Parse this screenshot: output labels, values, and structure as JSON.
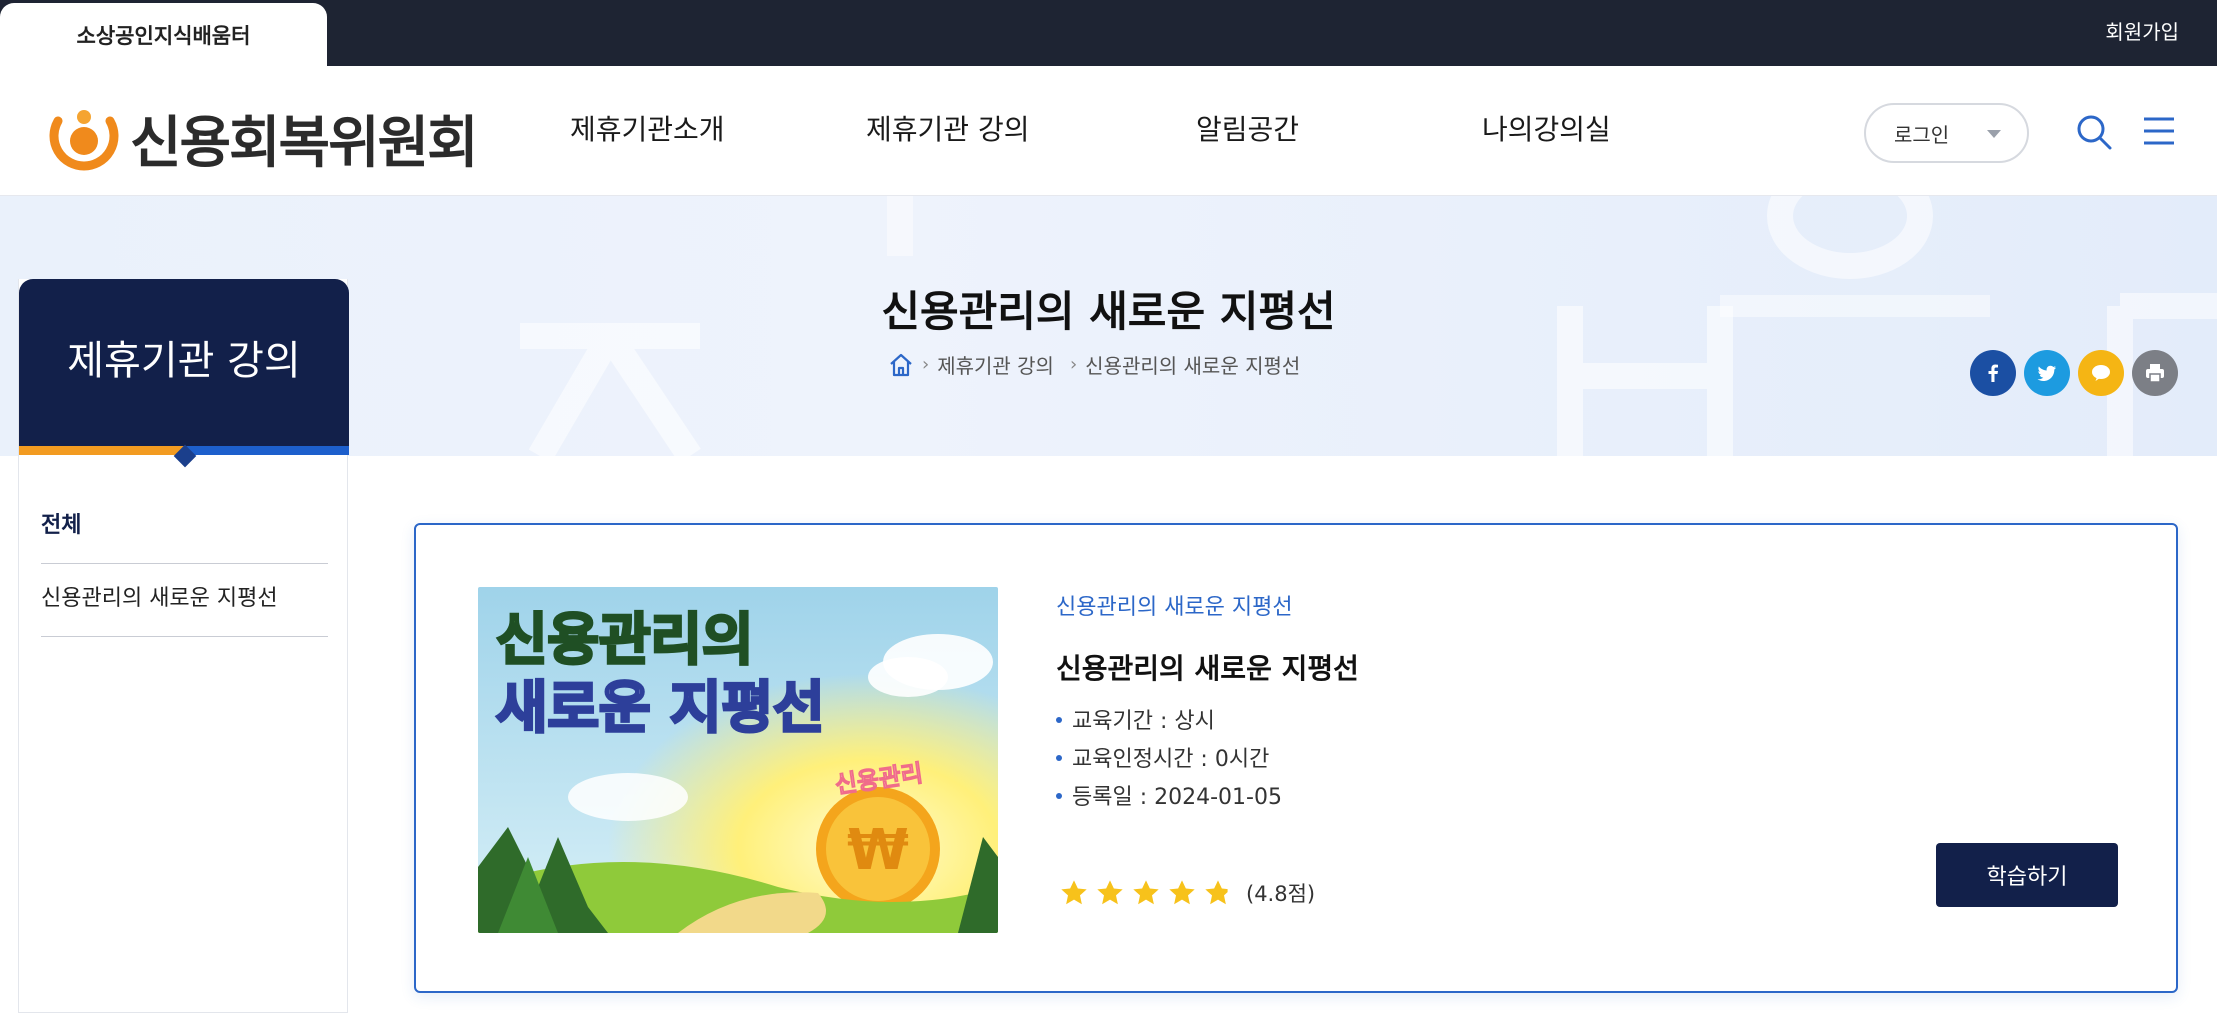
{
  "topbar": {
    "site_tab": "소상공인지식배움터",
    "signup": "회원가입"
  },
  "header": {
    "logo_text": "신용회복위원회",
    "nav": [
      "제휴기관소개",
      "제휴기관 강의",
      "알림공간",
      "나의강의실"
    ],
    "login_select": "로그인"
  },
  "hero": {
    "title": "신용관리의 새로운 지평선",
    "breadcrumb": [
      "제휴기관 강의",
      "신용관리의 새로운 지평선"
    ],
    "share_icons": [
      "facebook-icon",
      "twitter-icon",
      "kakao-talk-icon",
      "print-icon"
    ]
  },
  "sidebar": {
    "title": "제휴기관 강의",
    "items": [
      {
        "label": "전체",
        "active": true
      },
      {
        "label": "신용관리의 새로운 지평선",
        "active": false
      }
    ]
  },
  "course": {
    "thumbnail_title_line1": "신용관리의",
    "thumbnail_title_line2": "새로운 지평선",
    "thumbnail_badge": "신용관리",
    "thumbnail_coin": "₩",
    "tag": "신용관리의 새로운 지평선",
    "title": "신용관리의 새로운 지평선",
    "info": [
      "교육기간 : 상시",
      "교육인정시간 : 0시간",
      "등록일 : 2024-01-05"
    ],
    "rating_value": 4.8,
    "rating_text": "(4.8점)",
    "button": "학습하기"
  },
  "colors": {
    "navy": "#12204a",
    "topbar": "#1e2433",
    "accent_blue": "#2c67c8",
    "orange": "#f29b21",
    "star": "#f7c21b"
  }
}
